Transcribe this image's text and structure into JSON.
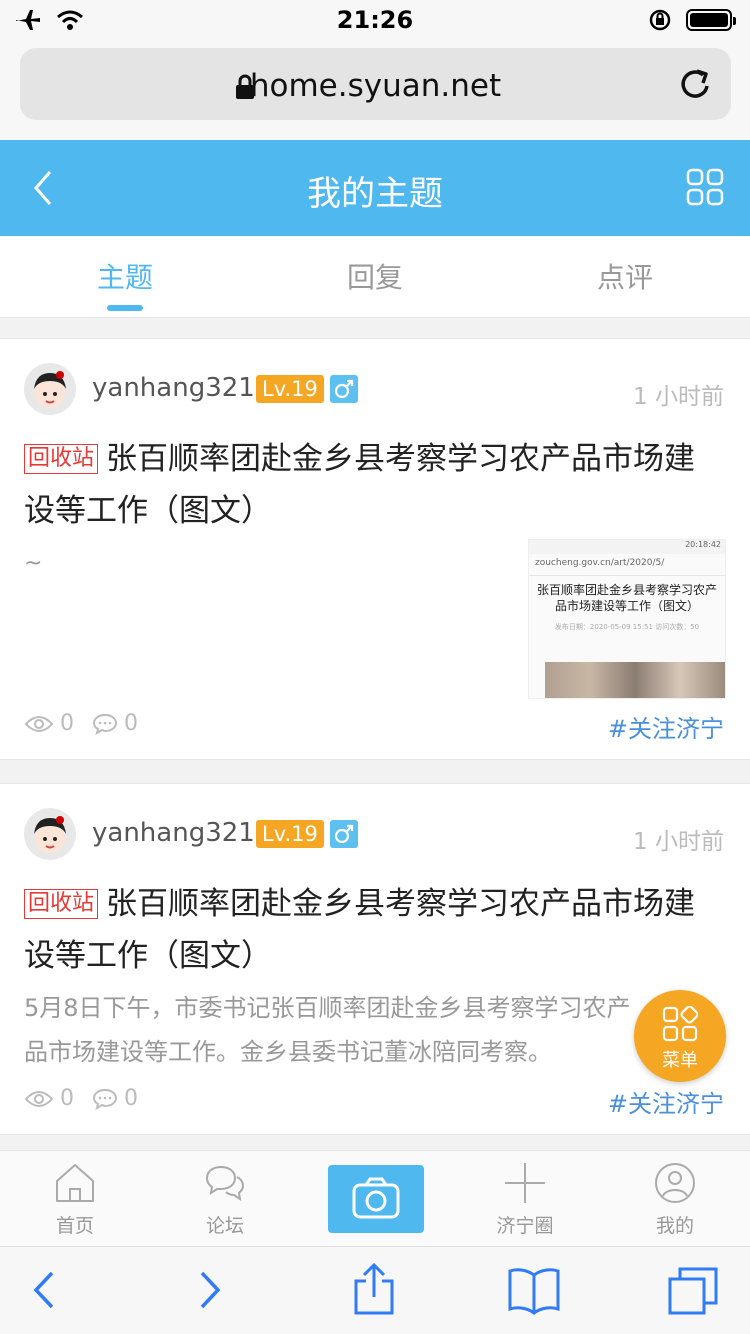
{
  "status_bar": {
    "time": "21:26"
  },
  "browser": {
    "url": "home.syuan.net"
  },
  "header": {
    "title": "我的主题"
  },
  "tabs": [
    {
      "label": "主题",
      "active": true
    },
    {
      "label": "回复",
      "active": false
    },
    {
      "label": "点评",
      "active": false
    }
  ],
  "posts": [
    {
      "username": "yanhang321",
      "level": "Lv.19",
      "time": "1 小时前",
      "tag": "回收站",
      "title": "张百顺率团赴金乡县考察学习农产品市场建设等工作（图文）",
      "excerpt": "~",
      "thumbnail": {
        "status_time": "20:18:42",
        "url": "zoucheng.gov.cn/art/2020/5/",
        "title": "张百顺率团赴金乡县考察学习农产品市场建设等工作（图文）",
        "meta": "发布日期：2020-05-09 15:51    访问次数：50"
      },
      "views": "0",
      "comments": "0",
      "topic": "#关注济宁"
    },
    {
      "username": "yanhang321",
      "level": "Lv.19",
      "time": "1 小时前",
      "tag": "回收站",
      "title": "张百顺率团赴金乡县考察学习农产品市场建设等工作（图文）",
      "excerpt": "5月8日下午，市委书记张百顺率团赴金乡县考察学习农产品市场建设等工作。金乡县委书记董冰陪同考察。",
      "views": "0",
      "comments": "0",
      "topic": "#关注济宁"
    }
  ],
  "fab": {
    "label": "菜单"
  },
  "app_nav": [
    {
      "label": "首页",
      "icon": "home-icon"
    },
    {
      "label": "论坛",
      "icon": "chat-icon"
    },
    {
      "label": "",
      "icon": "camera-icon"
    },
    {
      "label": "济宁圈",
      "icon": "plus-icon"
    },
    {
      "label": "我的",
      "icon": "user-icon"
    }
  ],
  "colors": {
    "accent": "#4fb8ef",
    "level_badge": "#f5a623",
    "tag_red": "#e53935",
    "topic_link": "#4a90d9"
  }
}
